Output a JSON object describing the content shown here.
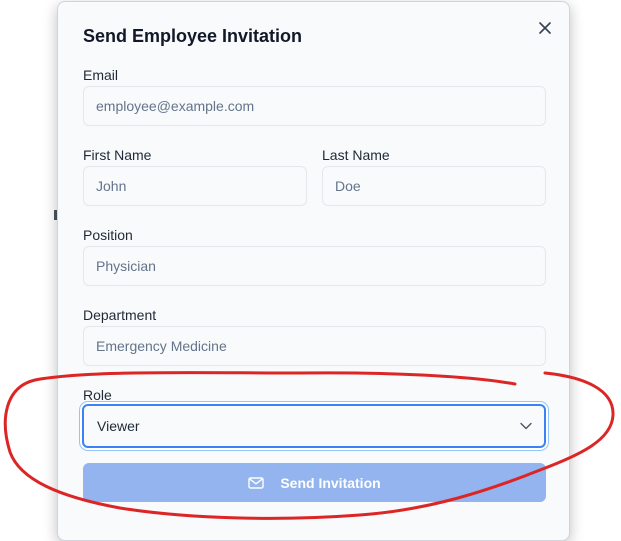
{
  "dialog": {
    "title": "Send Employee Invitation",
    "close_icon": "close-icon"
  },
  "form": {
    "email": {
      "label": "Email",
      "placeholder": "employee@example.com",
      "value": ""
    },
    "first_name": {
      "label": "First Name",
      "placeholder": "John",
      "value": ""
    },
    "last_name": {
      "label": "Last Name",
      "placeholder": "Doe",
      "value": ""
    },
    "position": {
      "label": "Position",
      "placeholder": "Physician",
      "value": ""
    },
    "department": {
      "label": "Department",
      "placeholder": "Emergency Medicine",
      "value": ""
    },
    "role": {
      "label": "Role",
      "selected": "Viewer",
      "icon": "chevron-down-icon"
    }
  },
  "submit": {
    "label": "Send Invitation",
    "icon": "mail-icon",
    "disabled": true
  },
  "annotation": {
    "type": "freehand-circle",
    "color": "#dc2626"
  }
}
